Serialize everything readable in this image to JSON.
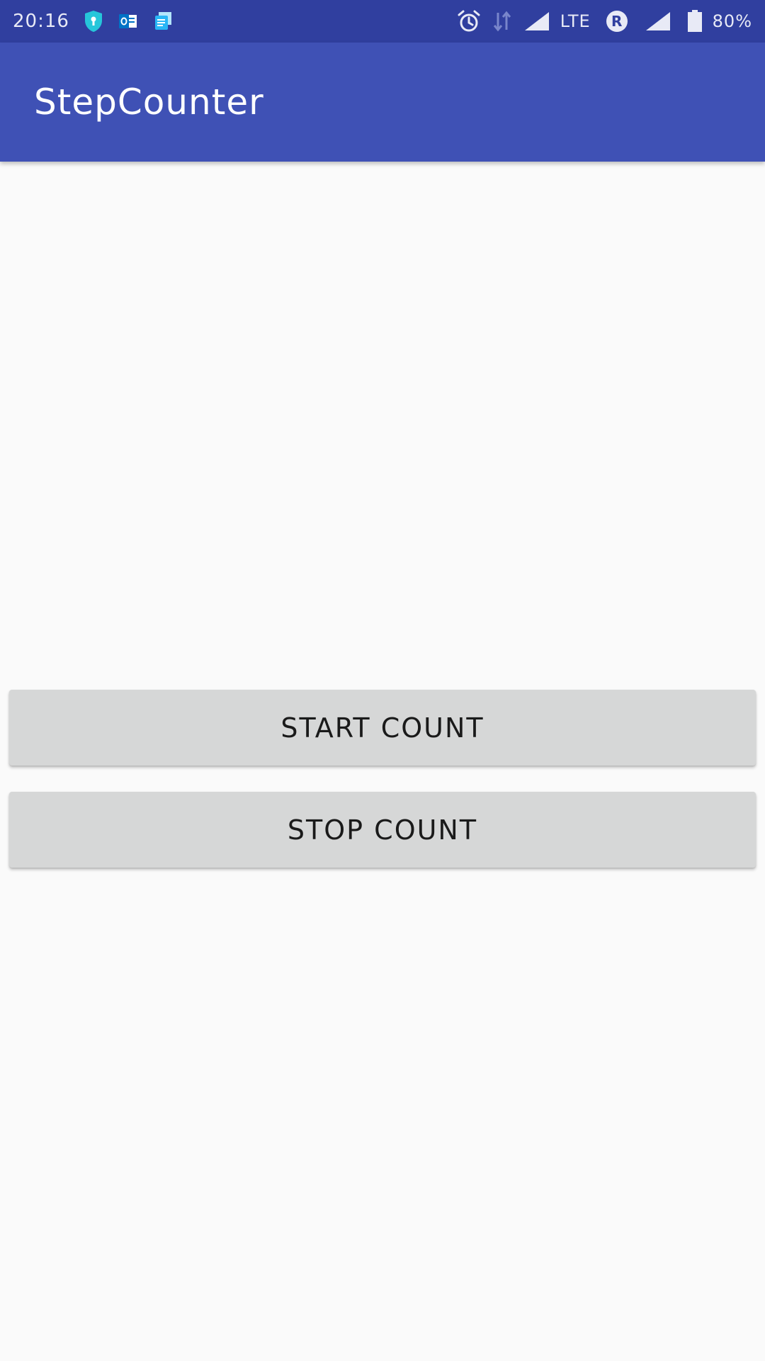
{
  "status_bar": {
    "time": "20:16",
    "network_type": "LTE",
    "roaming_badge": "R",
    "battery_percent": "80%",
    "left_icons": [
      "shield-icon",
      "outlook-icon",
      "news-icon"
    ],
    "right_icons": [
      "alarm-icon",
      "data-arrows-icon",
      "signal-icon",
      "roaming-icon",
      "signal-icon",
      "battery-icon"
    ],
    "colors": {
      "background": "#303f9f",
      "foreground": "#e8eaf6",
      "shield": "#26c6da",
      "outlook": "#0072c6",
      "news": "#29b6f6"
    }
  },
  "app_bar": {
    "title": "StepCounter",
    "color": "#3f51b5"
  },
  "main": {
    "background": "#fafafa",
    "buttons": {
      "start_label": "START COUNT",
      "stop_label": "STOP COUNT",
      "color": "#d6d7d7"
    }
  }
}
